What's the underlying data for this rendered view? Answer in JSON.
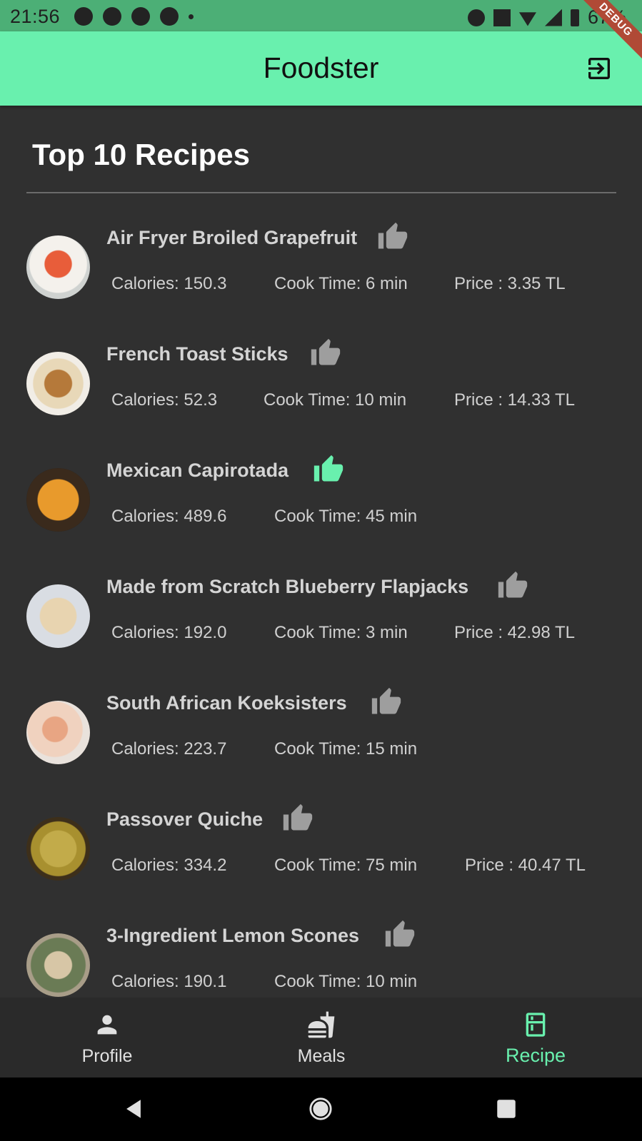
{
  "status_bar": {
    "time": "21:56",
    "battery": "67%"
  },
  "debug_label": "DEBUG",
  "app_bar": {
    "title": "Foodster",
    "logout_icon": "logout-icon"
  },
  "section_title": "Top 10 Recipes",
  "colors": {
    "accent": "#69f0ae",
    "background": "#303030",
    "liked": "#69f0ae",
    "unliked": "#9e9e9e"
  },
  "recipes": [
    {
      "name": "Air Fryer Broiled Grapefruit",
      "liked": false,
      "calories": "Calories:  150.3",
      "cook_time": "Cook Time: 6 min",
      "price": "Price : 3.35 TL"
    },
    {
      "name": "French Toast Sticks",
      "liked": false,
      "calories": "Calories:  52.3",
      "cook_time": "Cook Time: 10 min",
      "price": "Price : 14.33 TL"
    },
    {
      "name": "Mexican Capirotada",
      "liked": true,
      "calories": "Calories:  489.6",
      "cook_time": "Cook Time: 45 min",
      "price": ""
    },
    {
      "name": "Made from Scratch Blueberry Flapjacks",
      "liked": false,
      "calories": "Calories:  192.0",
      "cook_time": "Cook Time: 3 min",
      "price": "Price : 42.98 TL"
    },
    {
      "name": "South African Koeksisters",
      "liked": false,
      "calories": "Calories:  223.7",
      "cook_time": "Cook Time: 15 min",
      "price": ""
    },
    {
      "name": "Passover Quiche",
      "liked": false,
      "calories": "Calories:  334.2",
      "cook_time": "Cook Time: 75 min",
      "price": "Price : 40.47 TL"
    },
    {
      "name": "3-Ingredient Lemon Scones",
      "liked": false,
      "calories": "Calories:  190.1",
      "cook_time": "Cook Time: 10 min",
      "price": ""
    }
  ],
  "bottom_nav": {
    "items": [
      {
        "label": "Profile",
        "icon": "person-icon",
        "active": false
      },
      {
        "label": "Meals",
        "icon": "fastfood-icon",
        "active": false
      },
      {
        "label": "Recipe",
        "icon": "kitchen-icon",
        "active": true
      }
    ]
  }
}
